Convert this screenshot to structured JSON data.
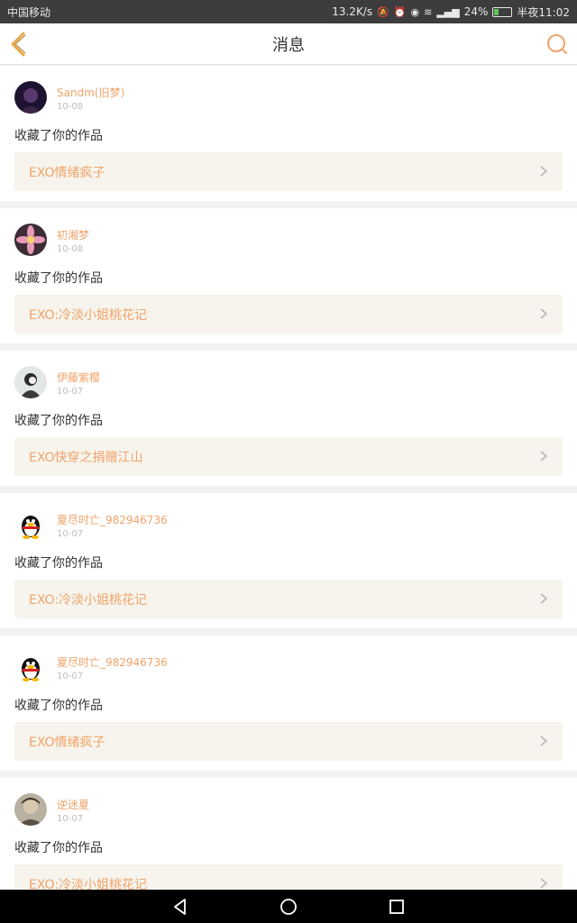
{
  "status_bar": {
    "carrier": "中国移动",
    "speed": "13.2K/s",
    "battery": "24%",
    "battery_level": 0.24,
    "time": "半夜11:02"
  },
  "header": {
    "title": "消息",
    "back_icon": "back-chevron-icon",
    "search_icon": "search-icon",
    "accent_color": "#e8a94c"
  },
  "messages": [
    {
      "user": "Sandm(旧梦)",
      "date": "10-08",
      "action": "收藏了你的作品",
      "work": "EXO情绪疯子",
      "avatar": "dark-photo"
    },
    {
      "user": "初湘梦",
      "date": "10-08",
      "action": "收藏了你的作品",
      "work": "EXO:冷淡小姐桃花记",
      "avatar": "lotus"
    },
    {
      "user": "伊藤紫樱",
      "date": "10-07",
      "action": "收藏了你的作品",
      "work": "EXO快穿之捐赠江山",
      "avatar": "girl-sketch"
    },
    {
      "user": "夏尽时亡_982946736",
      "date": "10-07",
      "action": "收藏了你的作品",
      "work": "EXO:冷淡小姐桃花记",
      "avatar": "qq-penguin"
    },
    {
      "user": "夏尽时亡_982946736",
      "date": "10-07",
      "action": "收藏了你的作品",
      "work": "EXO情绪疯子",
      "avatar": "qq-penguin"
    },
    {
      "user": "逆迷夏",
      "date": "10-07",
      "action": "收藏了你的作品",
      "work": "EXO:冷淡小姐桃花记",
      "avatar": "boy-photo"
    }
  ],
  "nav_bar": {
    "back": "nav-back-icon",
    "home": "nav-home-icon",
    "recents": "nav-recents-icon"
  }
}
